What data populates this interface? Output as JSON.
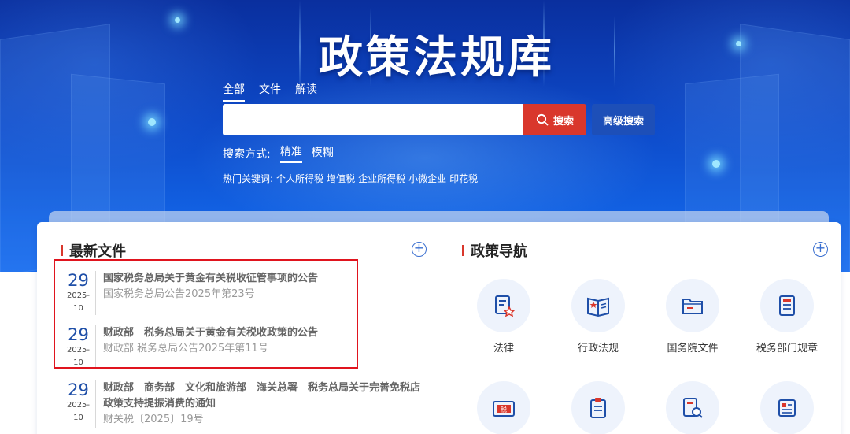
{
  "hero": {
    "title": "政策法规库",
    "tabs": [
      "全部",
      "文件",
      "解读"
    ],
    "search": {
      "placeholder": "",
      "button_label": "搜索",
      "advanced_label": "高级搜索"
    },
    "mode": {
      "label": "搜索方式:",
      "options": [
        "精准",
        "模糊"
      ]
    },
    "hot": {
      "label": "热门关键词:",
      "keywords": [
        "个人所得税",
        "增值税",
        "企业所得税",
        "小微企业",
        "印花税"
      ]
    }
  },
  "latest": {
    "title": "最新文件",
    "docs": [
      {
        "day": "29",
        "ym": "2025-10",
        "title": "国家税务总局关于黄金有关税收征管事项的公告",
        "title2": "",
        "sub": "国家税务总局公告2025年第23号"
      },
      {
        "day": "29",
        "ym": "2025-10",
        "title": "财政部　税务总局关于黄金有关税收政策的公告",
        "title2": "",
        "sub": "财政部 税务总局公告2025年第11号"
      },
      {
        "day": "29",
        "ym": "2025-10",
        "title": "财政部　商务部　文化和旅游部　海关总署　税务总局关于完善免税店",
        "title2": "政策支持提振消费的通知",
        "sub": "财关税〔2025〕19号"
      }
    ]
  },
  "nav": {
    "title": "政策导航",
    "items": [
      {
        "label": "法律",
        "icon": "law-doc-icon"
      },
      {
        "label": "行政法规",
        "icon": "open-book-star-icon"
      },
      {
        "label": "国务院文件",
        "icon": "folder-icon"
      },
      {
        "label": "税务部门规章",
        "icon": "rule-doc-icon"
      },
      {
        "label": "",
        "icon": "tax-folder-icon"
      },
      {
        "label": "",
        "icon": "clipboard-icon"
      },
      {
        "label": "",
        "icon": "doc-search-icon"
      },
      {
        "label": "",
        "icon": "article-icon"
      }
    ]
  },
  "colors": {
    "accent_red": "#d9372c",
    "brand_blue": "#1f4fa8",
    "highlight": "#e0141e"
  }
}
